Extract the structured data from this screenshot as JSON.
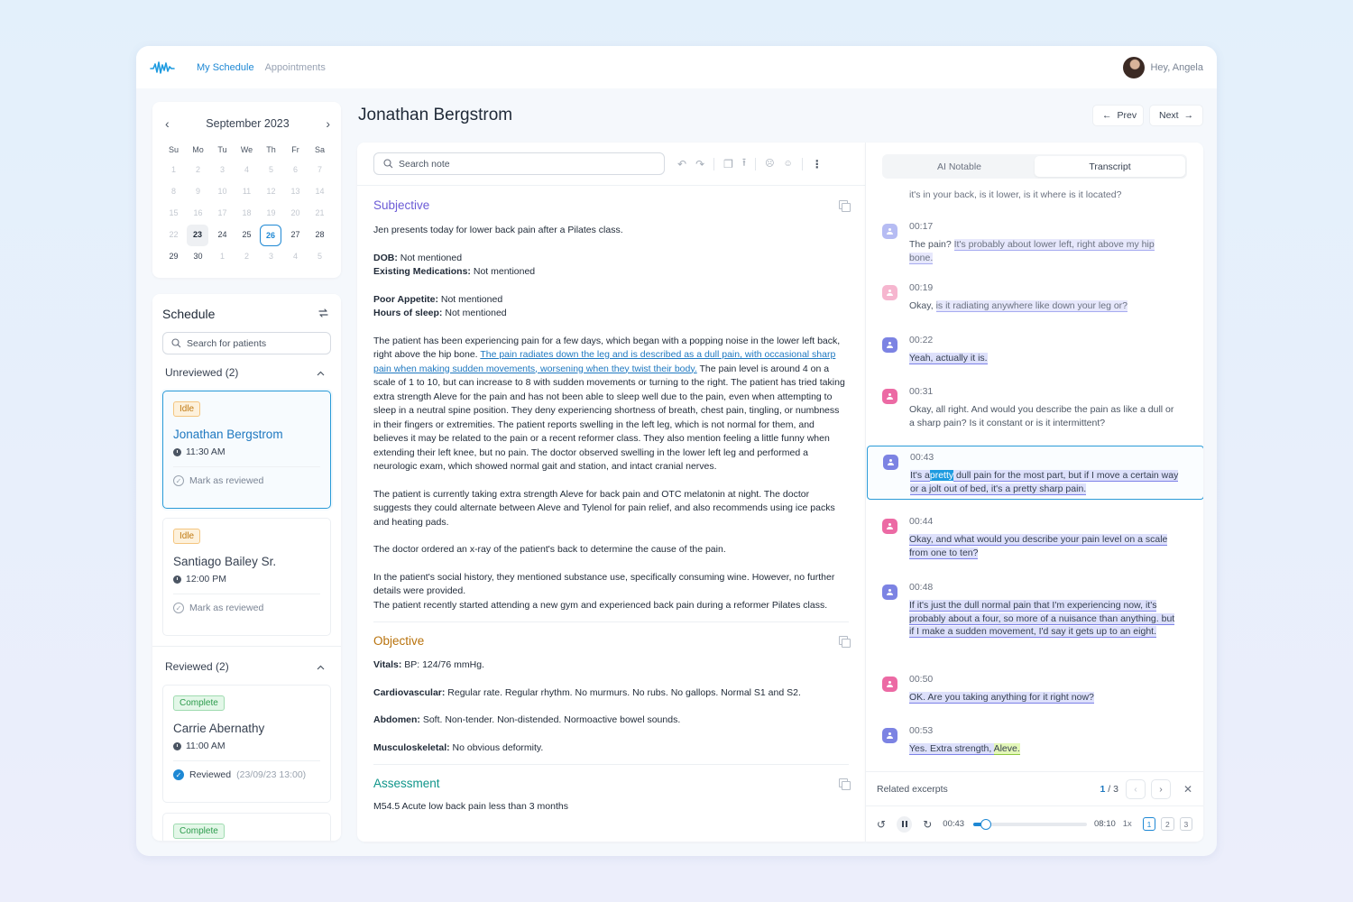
{
  "nav": {
    "tabs": [
      "My Schedule",
      "Appointments"
    ],
    "greeting": "Hey, Angela"
  },
  "calendar": {
    "month": "September 2023",
    "dow": [
      "Su",
      "Mo",
      "Tu",
      "We",
      "Th",
      "Fr",
      "Sa"
    ],
    "days": [
      [
        "1",
        "2",
        "3",
        "4",
        "5",
        "6",
        "7"
      ],
      [
        "8",
        "9",
        "10",
        "11",
        "12",
        "13",
        "14"
      ],
      [
        "15",
        "16",
        "17",
        "18",
        "19",
        "20",
        "21"
      ],
      [
        "22",
        "23",
        "24",
        "25",
        "26",
        "27",
        "28"
      ],
      [
        "29",
        "30",
        "1",
        "2",
        "3",
        "4",
        "5"
      ]
    ],
    "selected": "23",
    "today": "26"
  },
  "schedule": {
    "title": "Schedule",
    "search_placeholder": "Search for patients",
    "unreviewed_label": "Unreviewed (2)",
    "reviewed_label": "Reviewed (2)",
    "unreviewed": [
      {
        "status": "Idle",
        "name": "Jonathan Bergstrom",
        "time": "11:30 AM",
        "review": "Mark as reviewed"
      },
      {
        "status": "Idle",
        "name": "Santiago Bailey Sr.",
        "time": "12:00 PM",
        "review": "Mark as reviewed"
      }
    ],
    "reviewed": [
      {
        "status": "Complete",
        "name": "Carrie Abernathy",
        "time": "11:00 AM",
        "review": "Reviewed",
        "review_date": "(23/09/23 13:00)"
      },
      {
        "status": "Complete"
      }
    ]
  },
  "header": {
    "patient": "Jonathan Bergstrom",
    "prev": "Prev",
    "next": "Next"
  },
  "note": {
    "search_placeholder": "Search note",
    "subjective": {
      "title": "Subjective",
      "intro": "Jen presents today for lower back pain after a Pilates class.",
      "dob_label": "DOB:",
      "dob_value": " Not mentioned",
      "meds_label": "Existing Medications:",
      "meds_value": " Not mentioned",
      "appetite_label": "Poor Appetite:",
      "appetite_value": " Not mentioned",
      "sleep_label": "Hours of sleep:",
      "sleep_value": " Not mentioned",
      "p1_pre": "The patient has been experiencing pain for a few days, which began with a popping noise in the lower left back, right above the hip bone. ",
      "p1_link": "The pain radiates down the leg and is described as a dull pain, with occasional sharp pain when making sudden movements, worsening when they twist their body.",
      "p1_post": " The pain level is around 4 on a scale of 1 to 10, but can increase to 8 with sudden movements or turning to the right. The patient has tried taking extra strength Aleve for the pain and has not been able to sleep well due to the pain, even when attempting to sleep in a neutral spine position. They deny experiencing shortness of breath, chest pain, tingling, or numbness in their fingers or extremities. The patient reports swelling in the left leg, which is not normal for them, and believes it may be related to the pain or a recent reformer class. They also mention feeling a little funny when extending their left knee, but no pain. The doctor observed swelling in the lower left leg and performed a neurologic exam, which showed normal gait and station, and intact cranial nerves.",
      "p2": "The patient is currently taking extra strength Aleve for back pain and OTC melatonin at night. The doctor suggests they could alternate between Aleve and Tylenol for pain relief, and also recommends using ice packs and heating pads.",
      "p3": "The doctor ordered an x-ray of the patient's back to determine the cause of the pain.",
      "p4": "In the patient's social history, they mentioned substance use, specifically consuming wine. However, no further details were provided.",
      "p5": "The patient recently started attending a new gym and experienced back pain during a reformer Pilates class."
    },
    "objective": {
      "title": "Objective",
      "vitals_label": "Vitals:",
      "vitals_value": " BP: 124/76 mmHg.",
      "cardio_label": "Cardiovascular:",
      "cardio_value": " Regular rate. Regular rhythm. No murmurs. No rubs. No gallops. Normal S1 and S2.",
      "abd_label": "Abdomen:",
      "abd_value": " Soft. Non-tender. Non-distended. Normoactive bowel sounds.",
      "msk_label": "Musculoskeletal:",
      "msk_value": " No  obvious deformity."
    },
    "assessment": {
      "title": "Assessment",
      "line": "M54.5 Acute low back pain less than 3 months"
    }
  },
  "transcript": {
    "tabs": [
      "AI Notable",
      "Transcript"
    ],
    "cut_line": "it's in your back, is it lower, is it where is it located?",
    "messages": [
      {
        "ts": "00:17",
        "pre": "The pain? ",
        "hl": "It's probably about lower left, right above my hip bone.",
        "post": ""
      },
      {
        "ts": "00:19",
        "pre": "Okay, ",
        "hl": "is it radiating anywhere like down your leg or?",
        "post": ""
      },
      {
        "ts": "00:22",
        "pre": "",
        "hl": "Yeah, actually it is.",
        "post": ""
      },
      {
        "ts": "00:31",
        "pre": "Okay, all right. And would you describe the pain as like a dull or a sharp pain? Is it constant or is it intermittent?",
        "hl": "",
        "post": ""
      },
      {
        "ts": "00:43",
        "a": "It's a",
        "cur": "pretty",
        "b": " dull pain for the most part, but if I move a certain way or a jolt out of bed, it's a pretty sharp pain."
      },
      {
        "ts": "00:44",
        "pre": "",
        "hl": "Okay, and what would you describe your pain level on a scale from one to ten? ",
        "post": ""
      },
      {
        "ts": "00:48",
        "pre": "",
        "hl": "If it's just the dull normal pain that I'm experiencing now, it's probably about a four, so more of a nuisance than anything. but if I make a sudden movement, I'd say it gets up to an eight.",
        "post": ""
      },
      {
        "ts": "00:50",
        "pre": "",
        "hl": "OK. Are you taking anything for it right now?",
        "post": ""
      },
      {
        "ts": "00:53",
        "hl": " Yes. Extra strength, ",
        "green": "Aleve."
      }
    ],
    "excerpts_label": "Related excerpts",
    "excerpt_current": "1",
    "excerpt_total": " / 3",
    "player": {
      "current": "00:43",
      "total": "08:10",
      "speed": "1x",
      "progress": 0.088,
      "speakers": [
        "1",
        "2",
        "3"
      ]
    }
  },
  "colors": {
    "accent": "#1e88d4",
    "subjective": "#6b5bd6",
    "objective": "#b8720c",
    "assessment": "#0f958a"
  }
}
